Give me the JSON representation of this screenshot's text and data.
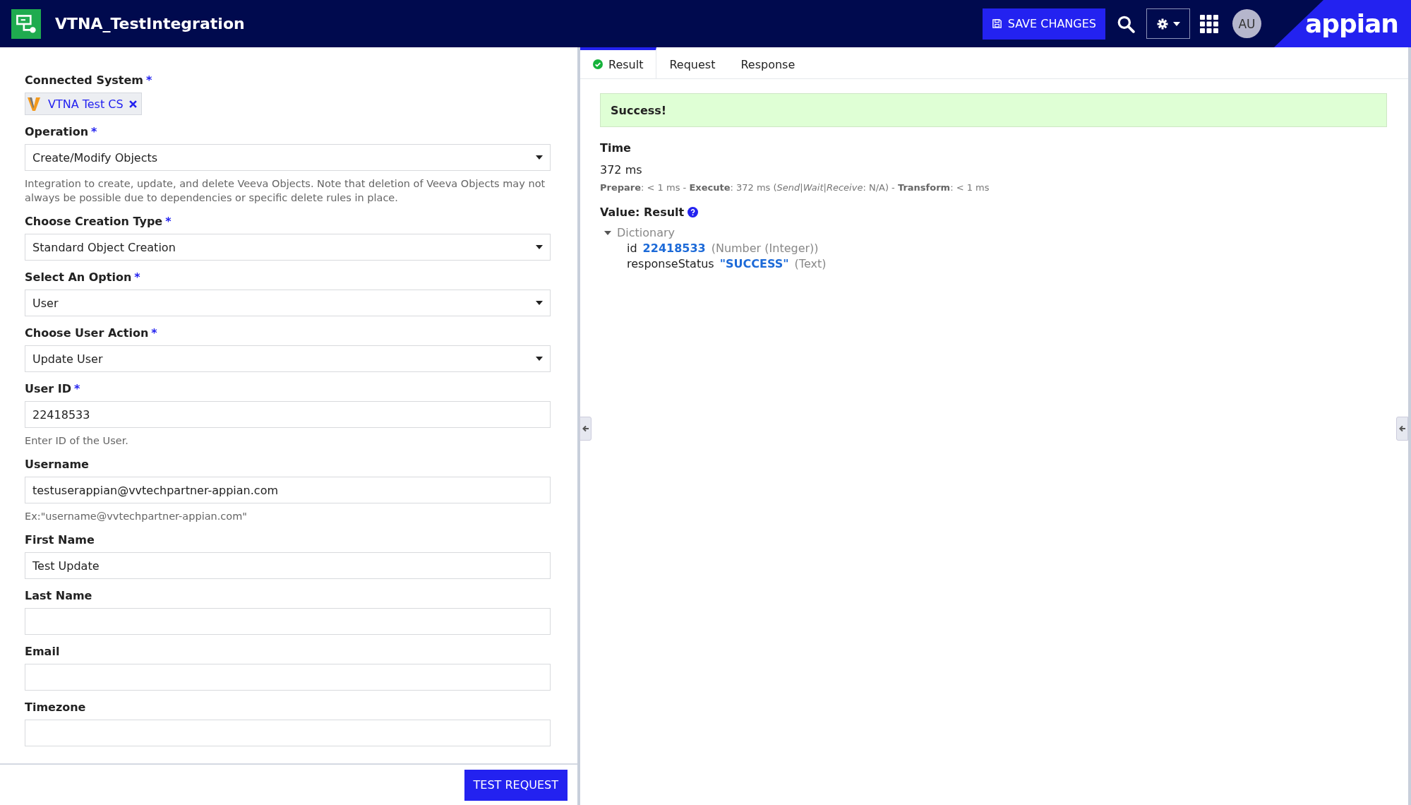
{
  "header": {
    "title": "VTNA_TestIntegration",
    "save_button": "SAVE CHANGES",
    "avatar": "AU",
    "logo": "appian"
  },
  "form": {
    "fields": [
      {
        "kind": "chip",
        "label": "Connected System",
        "required_mark": "*",
        "value": "VTNA Test CS"
      },
      {
        "kind": "dropdown",
        "label": "Operation",
        "required_mark": "*",
        "value": "Create/Modify Objects",
        "help": "Integration to create, update, and delete Veeva Objects. Note that deletion of Veeva Objects may not always be possible due to dependencies or specific delete rules in place."
      },
      {
        "kind": "dropdown",
        "label": "Choose Creation Type",
        "required_mark": "*",
        "value": "Standard Object Creation"
      },
      {
        "kind": "dropdown",
        "label": "Select An Option",
        "required_mark": "*",
        "value": "User"
      },
      {
        "kind": "dropdown",
        "label": "Choose User Action",
        "required_mark": "*",
        "value": "Update User"
      },
      {
        "kind": "text",
        "label": "User ID",
        "required_mark": "*",
        "value": "22418533",
        "help": "Enter ID of the User."
      },
      {
        "kind": "text",
        "label": "Username",
        "value": "testuserappian@vvtechpartner-appian.com",
        "help": "Ex:\"username@vvtechpartner-appian.com\""
      },
      {
        "kind": "text",
        "label": "First Name",
        "value": "Test Update"
      },
      {
        "kind": "text",
        "label": "Last Name"
      },
      {
        "kind": "text",
        "label": "Email"
      },
      {
        "kind": "text",
        "label": "Timezone"
      }
    ],
    "test_button": "TEST REQUEST"
  },
  "result_panel": {
    "tabs": [
      {
        "kind": "success",
        "label": "Result",
        "selected": true
      },
      {
        "kind": "plain",
        "label": "Request",
        "selected": false
      },
      {
        "kind": "plain",
        "label": "Response",
        "selected": false
      }
    ],
    "banner": "Success!",
    "time_label": "Time",
    "time_value": "372 ms",
    "time_detail": "**Prepare**: < 1 ms - **Execute**: 372 ms (*Send|Wait|Receive*: N/A) - **Transform**: < 1 ms",
    "value_label": "Value: Result",
    "tree": {
      "label": "Dictionary",
      "expanded": true,
      "children": [
        {
          "key": "id",
          "value": "22418533",
          "type": "(Number (Integer))"
        },
        {
          "key": "responseStatus",
          "value": "\"SUCCESS\"",
          "type": "(Text)"
        }
      ]
    }
  }
}
